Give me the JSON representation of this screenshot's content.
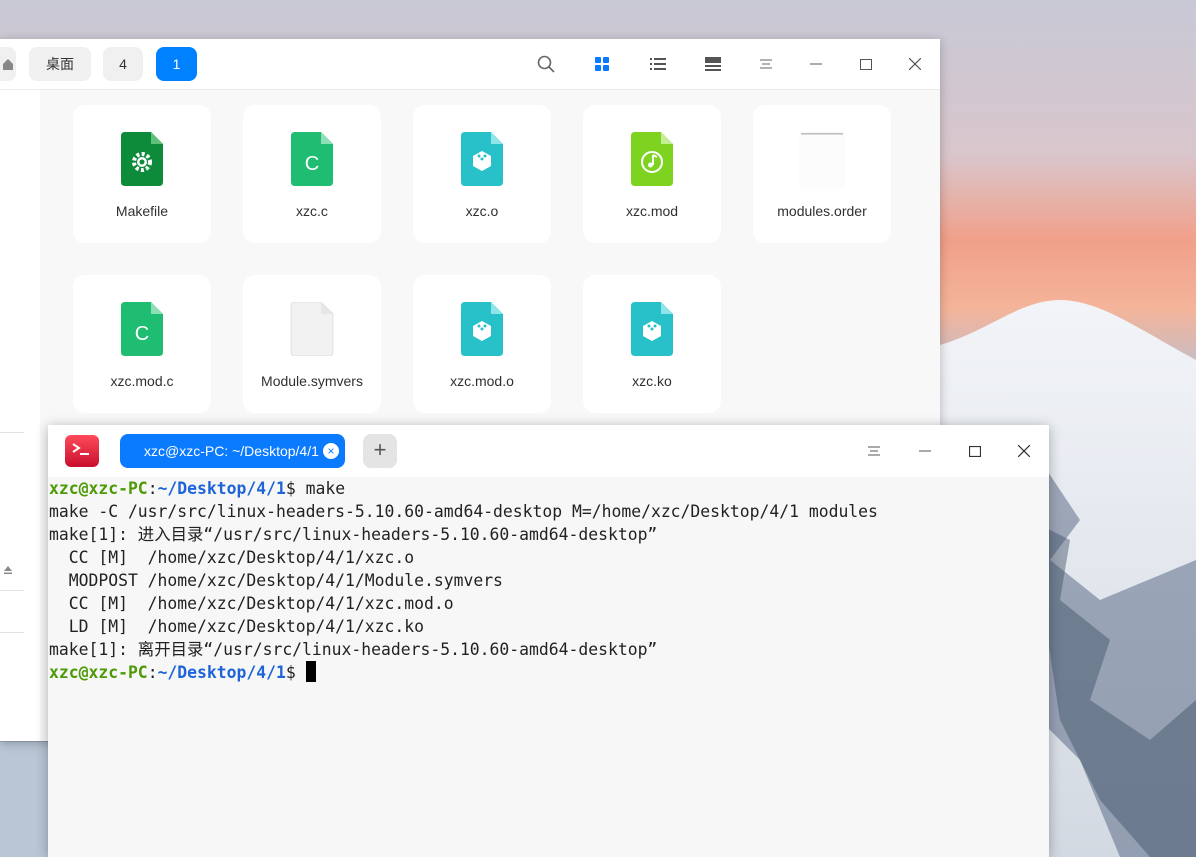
{
  "file_manager": {
    "breadcrumbs": [
      {
        "label": "桌面",
        "active": false
      },
      {
        "label": "4",
        "active": false
      },
      {
        "label": "1",
        "active": true
      }
    ],
    "toolbar_icons": [
      "search-icon",
      "icon-view-icon",
      "list-view-icon",
      "detail-view-icon",
      "menu-icon",
      "minimize-icon",
      "maximize-icon",
      "close-icon"
    ],
    "files": [
      {
        "name": "Makefile",
        "icon": "makefile-gear-icon"
      },
      {
        "name": "xzc.c",
        "icon": "c-source-icon"
      },
      {
        "name": "xzc.o",
        "icon": "object-file-icon"
      },
      {
        "name": "xzc.mod",
        "icon": "audio-file-icon"
      },
      {
        "name": "modules.order",
        "icon": "text-file-icon"
      },
      {
        "name": "xzc.mod.c",
        "icon": "c-source-icon"
      },
      {
        "name": "Module.symvers",
        "icon": "blank-file-icon"
      },
      {
        "name": "xzc.mod.o",
        "icon": "object-file-icon"
      },
      {
        "name": "xzc.ko",
        "icon": "object-file-icon"
      }
    ],
    "colors": {
      "accent": "#0081ff",
      "c_green": "#1ebd72",
      "obj_cyan": "#28c1c9",
      "make_green": "#0d8a3a",
      "audio_green": "#7ed321"
    }
  },
  "terminal": {
    "tab_title": "xzc@xzc-PC: ~/Desktop/4/1",
    "tab_close": "×",
    "new_tab": "+",
    "prompt_user": "xzc@xzc-PC",
    "prompt_sep": ":",
    "prompt_path": "~/Desktop/4/1",
    "prompt_dollar": "$ ",
    "command": "make",
    "output": [
      "make -C /usr/src/linux-headers-5.10.60-amd64-desktop M=/home/xzc/Desktop/4/1 modules",
      "make[1]: 进入目录“/usr/src/linux-headers-5.10.60-amd64-desktop”",
      "  CC [M]  /home/xzc/Desktop/4/1/xzc.o",
      "  MODPOST /home/xzc/Desktop/4/1/Module.symvers",
      "  CC [M]  /home/xzc/Desktop/4/1/xzc.mod.o",
      "  LD [M]  /home/xzc/Desktop/4/1/xzc.ko",
      "make[1]: 离开目录“/usr/src/linux-headers-5.10.60-amd64-desktop”"
    ],
    "colors": {
      "prompt_user": "#4e9a06",
      "prompt_path": "#1e64d8",
      "tab": "#0a7aff"
    }
  }
}
